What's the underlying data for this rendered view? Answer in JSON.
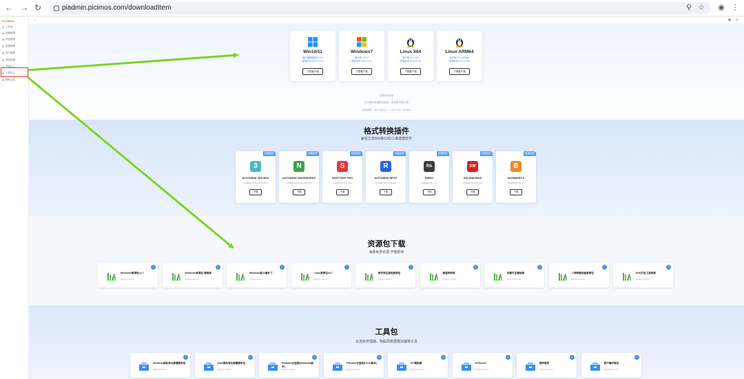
{
  "browser": {
    "url": "piadmin.picimos.com/downloadItem"
  },
  "sidebar": {
    "logo": "PI Admin",
    "items": [
      {
        "label": "工作台"
      },
      {
        "label": "设备管理"
      },
      {
        "label": "项目管理"
      },
      {
        "label": "数据管理"
      },
      {
        "label": "用户管理"
      },
      {
        "label": "系统设置"
      },
      {
        "label": "资源中心"
      },
      {
        "label": "下载中心"
      },
      {
        "label": "帮助文档"
      }
    ]
  },
  "os_cards": [
    {
      "name": "Win10/11",
      "sub1": "客户端最新版本 V3.0",
      "sub2": "更新时间 2024-01-05",
      "button": "下载客户端"
    },
    {
      "name": "Windows7",
      "sub1": "客户端 V2.9.0",
      "sub2": "更新时间 2023-12-01",
      "button": "下载客户端"
    },
    {
      "name": "Linux X64",
      "sub1": "客户端 V3.0 X64",
      "sub2": "更新时间 2024-01-05",
      "button": "下载客户端"
    },
    {
      "name": "Linux ARM64",
      "sub1": "客户端 V3.0 ARM64",
      "sub2": "更新时间 2024-01-05",
      "button": "下载客户端"
    }
  ],
  "os_links": {
    "line1": "查看历史版本",
    "line2": "如下载失败请联系客服，或查看 帮助文档",
    "line3": "系统要求：Win10及以上 / Linux X64 / ARM64"
  },
  "convert": {
    "title": "格式转换插件",
    "subtitle": "兼容主流BIM和CAD三维建模软件",
    "tag": "转换插件",
    "button": "下载",
    "plugins": [
      {
        "name": "AUTODESK 3DS MAX",
        "sub": "支持版本 3ds Max 2018-2024",
        "glyph": "3",
        "color": "#4cb9c6"
      },
      {
        "name": "AUTODESK NAVISWORKS",
        "sub": "支持版本 Navisworks 2018-2024",
        "glyph": "N",
        "color": "#3ea14a"
      },
      {
        "name": "SKETCHUP PRO",
        "sub": "支持版本 SU 2017-2023",
        "glyph": "S",
        "color": "#e53935"
      },
      {
        "name": "AUTODESK REVIT",
        "sub": "支持版本 Revit 2018-2024",
        "glyph": "R",
        "color": "#2667d8"
      },
      {
        "name": "RHINO",
        "sub": "支持版本 Rhino 6/7",
        "glyph": "Rh",
        "color": "#3c3c3c"
      },
      {
        "name": "SOLIDWORKS",
        "sub": "支持版本 SW 2018-2023",
        "glyph": "SW",
        "color": "#d92121"
      },
      {
        "name": "BLENDER3.5",
        "sub": "支持版本 Blender 3.5",
        "glyph": "B",
        "color": "#f08a24"
      }
    ]
  },
  "resources": {
    "title": "资源包下载",
    "subtitle": "海量免费资源 开箱即用",
    "items": [
      {
        "name": "Windows资源包v4.7",
        "sub": "更新时间 2024-01"
      },
      {
        "name": "Windows资源包-精简版",
        "sub": "更新时间 2023-12"
      },
      {
        "name": "Windows防火墙补丁",
        "sub": "更新时间 2023-11"
      },
      {
        "name": "Linux资源包v4.7",
        "sub": "更新时间 2024-01"
      },
      {
        "name": "数字孪生基础资源包",
        "sub": "更新时间 2023-10"
      },
      {
        "name": "模型样例库",
        "sub": "更新时间 2023-09"
      },
      {
        "name": "场景交互模板库",
        "sub": "更新时间 2023-08"
      },
      {
        "name": "人物骨骼动画资源包",
        "sub": "更新时间 2023-08"
      },
      {
        "name": "PAK打包工具资源",
        "sub": "更新时间 2023-07"
      }
    ]
  },
  "tools": {
    "title": "工具包",
    "subtitle": "云渲染管理器、物联网数据模拟器等工具",
    "items": [
      {
        "name": "windows版私有化部署服务包",
        "sub": "更新时间 2024-01"
      },
      {
        "name": "linux版私有化部署服务包",
        "sub": "更新时间 2024-01"
      },
      {
        "name": "PiStudio云渲染(Windows版本)",
        "sub": "更新时间 2023-12"
      },
      {
        "name": "PiStudio云渲染(Linux版本)",
        "sub": "更新时间 2023-12"
      },
      {
        "name": "IoT模拟器",
        "sub": "更新时间 2023-11"
      },
      {
        "name": "IoTServer",
        "sub": "更新时间 2023-11"
      },
      {
        "name": "插件服务",
        "sub": "更新时间 2023-10"
      },
      {
        "name": "客户端环境包",
        "sub": "更新时间 2023-10"
      }
    ]
  },
  "colors": {
    "accent": "#4a8df0",
    "arrow": "#7ed321",
    "highlight": "#e53935"
  }
}
